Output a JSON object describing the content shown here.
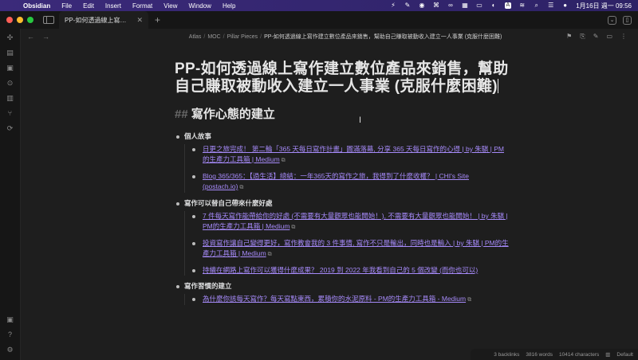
{
  "menubar": {
    "items": [
      "Obsidian",
      "File",
      "Edit",
      "Insert",
      "Format",
      "View",
      "Window",
      "Help"
    ],
    "datetime": "1月16日 週一 09:56",
    "input_badge": "A"
  },
  "tab": {
    "label": "PP-如何透過線上寫作建立數位產品來銷售，幫助自己賺取被動收入建立一人事業 (克服什麼困難)"
  },
  "breadcrumb": {
    "parts": [
      "Atlas",
      "MOC",
      "Pillar Pieces"
    ],
    "current": "PP-如何透過線上寫作建立數位產品來銷售，幫助自己賺取被動收入建立一人事業 (克服什麼困難)"
  },
  "note": {
    "title": "PP-如何透過線上寫作建立數位產品來銷售，幫助自己賺取被動收入建立一人事業 (克服什麼困難)",
    "heading_prefix": "##",
    "heading": "寫作心態的建立"
  },
  "sections": [
    {
      "label": "個人故事",
      "links": [
        "日更之旅完成！ 第二輪「365 天每日寫作計畫」圓滿落幕, 分享 365 天每日寫作的心得 | by 朱騏 | PM的生產力工具箱 | Medium",
        "Blog 365/365：【過生活】總結：一年365天的寫作之旅，我得到了什麼收穫？ | CHI's Site (postach.io)"
      ]
    },
    {
      "label": "寫作可以替自己帶來什麼好處",
      "links": [
        "7 件每天寫作能帶給你的好處 (不需要有大量觀眾也能開始！), 不需要有大量觀眾也能開始！ | by 朱騏 | PM的生產力工具箱 | Medium",
        "投資寫作讓自己變得更好，寫作教會我的 3 件事情, 寫作不只是輸出，同時也是輸入 | by 朱騏 | PM的生產力工具箱 | Medium",
        "持續在網路上寫作可以獲得什麼成果？ 2019 到 2022 年我看到自己的 5 個改變 (而你也可以)"
      ]
    },
    {
      "label": "寫作習慣的建立",
      "links": [
        "為什麼你該每天寫作？每天寫點東西，累積你的水泥原料 - PM的生產力工具箱 - Medium"
      ]
    }
  ],
  "status": {
    "backlinks": "3 backlinks",
    "words": "3816 words",
    "characters": "10414 characters",
    "theme": "Default"
  }
}
